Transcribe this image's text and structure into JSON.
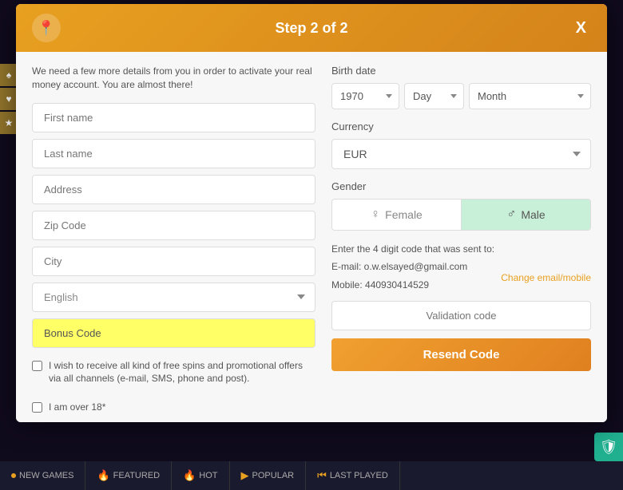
{
  "modal": {
    "header": {
      "title": "Step 2 of 2",
      "close_label": "X",
      "logo_icon": "pin-icon"
    },
    "subtitle": "We need a few more details from you in order to activate your real money account. You are almost there!",
    "left": {
      "first_name_placeholder": "First name",
      "last_name_placeholder": "Last name",
      "address_placeholder": "Address",
      "zip_placeholder": "Zip Code",
      "city_placeholder": "City",
      "language_value": "English",
      "bonus_code_value": "Bonus Code",
      "checkbox_label": "I wish to receive all kind of free spins and promotional offers via all channels (e-mail, SMS, phone and post)."
    },
    "right": {
      "birth_date_label": "Birth date",
      "year_value": "1970",
      "day_value": "Day",
      "month_value": "Month",
      "currency_label": "Currency",
      "currency_value": "EUR",
      "gender_label": "Gender",
      "female_label": "Female",
      "male_label": "Male",
      "validation_label": "Enter the 4 digit code that was sent to:",
      "email_label": "E-mail: o.w.elsayed@gmail.com",
      "mobile_label": "Mobile: 440930414529",
      "change_link": "Change email/mobile",
      "validation_placeholder": "Validation code",
      "resend_label": "Resend Code"
    },
    "footer": {
      "checkbox_label": "I am over 18*"
    }
  },
  "bottom_bar": {
    "items": [
      {
        "label": "GAMES",
        "prefix": "NEW"
      },
      {
        "label": "FEATURED"
      },
      {
        "label": "HOT"
      },
      {
        "label": "POPULAR"
      },
      {
        "label": "LAST PLAYED"
      }
    ]
  },
  "side_icons": [
    "♠",
    "♥",
    "★"
  ]
}
